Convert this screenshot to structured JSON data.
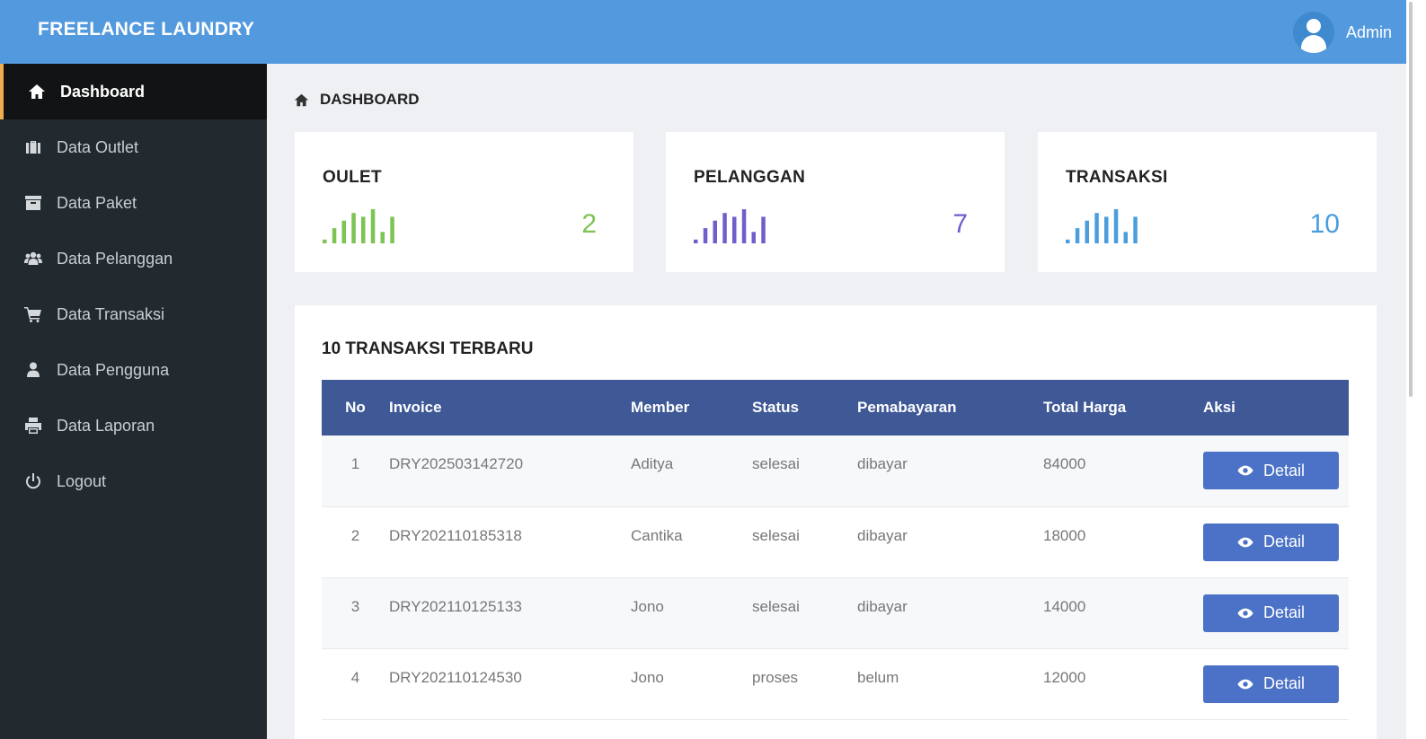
{
  "header": {
    "brand": "FREELANCE LAUNDRY",
    "user_name": "Admin",
    "color": "#5299de"
  },
  "sidebar": {
    "items": [
      {
        "label": "Dashboard",
        "icon": "home-icon",
        "active": true
      },
      {
        "label": "Data Outlet",
        "icon": "briefcase-icon"
      },
      {
        "label": "Data Paket",
        "icon": "archive-icon"
      },
      {
        "label": "Data Pelanggan",
        "icon": "users-icon"
      },
      {
        "label": "Data Transaksi",
        "icon": "cart-icon"
      },
      {
        "label": "Data Pengguna",
        "icon": "user-icon"
      },
      {
        "label": "Data Laporan",
        "icon": "print-icon"
      },
      {
        "label": "Logout",
        "icon": "power-icon"
      }
    ]
  },
  "breadcrumb": {
    "title": "DASHBOARD"
  },
  "stats": [
    {
      "title": "OULET",
      "value": "2",
      "color": "#7cc454",
      "spark": [
        1,
        4,
        6,
        8,
        7,
        9,
        3,
        7
      ]
    },
    {
      "title": "PELANGGAN",
      "value": "7",
      "color": "#6f5fcb",
      "spark": [
        1,
        4,
        6,
        8,
        7,
        9,
        3,
        7
      ]
    },
    {
      "title": "TRANSAKSI",
      "value": "10",
      "color": "#4a9ede",
      "spark": [
        1,
        4,
        6,
        8,
        7,
        9,
        3,
        7
      ]
    }
  ],
  "transactions": {
    "title": "10 TRANSAKSI TERBARU",
    "columns": [
      "No",
      "Invoice",
      "Member",
      "Status",
      "Pemabayaran",
      "Total Harga",
      "Aksi"
    ],
    "action_label": "Detail",
    "rows": [
      {
        "no": "1",
        "invoice": "DRY202503142720",
        "member": "Aditya",
        "status": "selesai",
        "payment": "dibayar",
        "total": "84000"
      },
      {
        "no": "2",
        "invoice": "DRY202110185318",
        "member": "Cantika",
        "status": "selesai",
        "payment": "dibayar",
        "total": "18000"
      },
      {
        "no": "3",
        "invoice": "DRY202110125133",
        "member": "Jono",
        "status": "selesai",
        "payment": "dibayar",
        "total": "14000"
      },
      {
        "no": "4",
        "invoice": "DRY202110124530",
        "member": "Jono",
        "status": "proses",
        "payment": "belum",
        "total": "12000"
      }
    ]
  }
}
